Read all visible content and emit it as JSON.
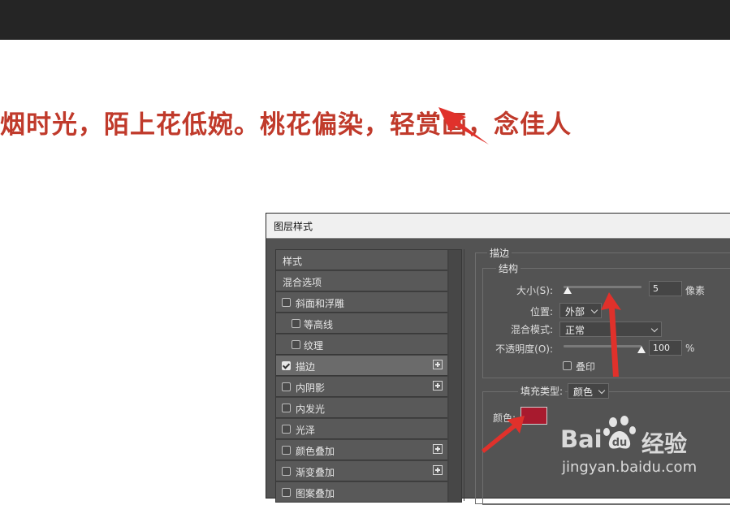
{
  "canvas": {
    "text": "烟时光，陌上花低婉。桃花偏染，轻赏画，念佳人"
  },
  "dialog": {
    "title": "图层样式",
    "style_list": {
      "items": [
        {
          "label": "样式",
          "type": "header"
        },
        {
          "label": "混合选项",
          "type": "header"
        },
        {
          "label": "斜面和浮雕",
          "checked": false,
          "indent": false,
          "plus": false
        },
        {
          "label": "等高线",
          "checked": false,
          "indent": true,
          "plus": false
        },
        {
          "label": "纹理",
          "checked": false,
          "indent": true,
          "plus": false
        },
        {
          "label": "描边",
          "checked": true,
          "indent": false,
          "plus": true,
          "active": true
        },
        {
          "label": "内阴影",
          "checked": false,
          "indent": false,
          "plus": true
        },
        {
          "label": "内发光",
          "checked": false,
          "indent": false,
          "plus": false
        },
        {
          "label": "光泽",
          "checked": false,
          "indent": false,
          "plus": false
        },
        {
          "label": "颜色叠加",
          "checked": false,
          "indent": false,
          "plus": true
        },
        {
          "label": "渐变叠加",
          "checked": false,
          "indent": false,
          "plus": true
        },
        {
          "label": "图案叠加",
          "checked": false,
          "indent": false,
          "plus": false
        }
      ]
    },
    "stroke": {
      "group_title": "描边",
      "structure_title": "结构",
      "size": {
        "label": "大小(S):",
        "value": "5",
        "unit": "像素",
        "slider_level": 0.05
      },
      "position": {
        "label": "位置:",
        "value": "外部"
      },
      "blend_mode": {
        "label": "混合模式:",
        "value": "正常"
      },
      "opacity": {
        "label": "不透明度(O):",
        "value": "100",
        "unit": "%",
        "slider_level": 1.0
      },
      "overprint": {
        "label": "叠印",
        "checked": false
      },
      "fill_type": {
        "label": "填充类型:",
        "value": "颜色"
      },
      "color": {
        "label": "颜色:",
        "value": "#a81a2e"
      }
    }
  },
  "watermark": {
    "bai": "Bai",
    "du": "du",
    "jingyan": "经验",
    "url": "jingyan.baidu.com"
  },
  "colors": {
    "annotation_red": "#e0312b",
    "canvas_text": "#c03a2b",
    "stroke_color": "#a81a2e"
  }
}
